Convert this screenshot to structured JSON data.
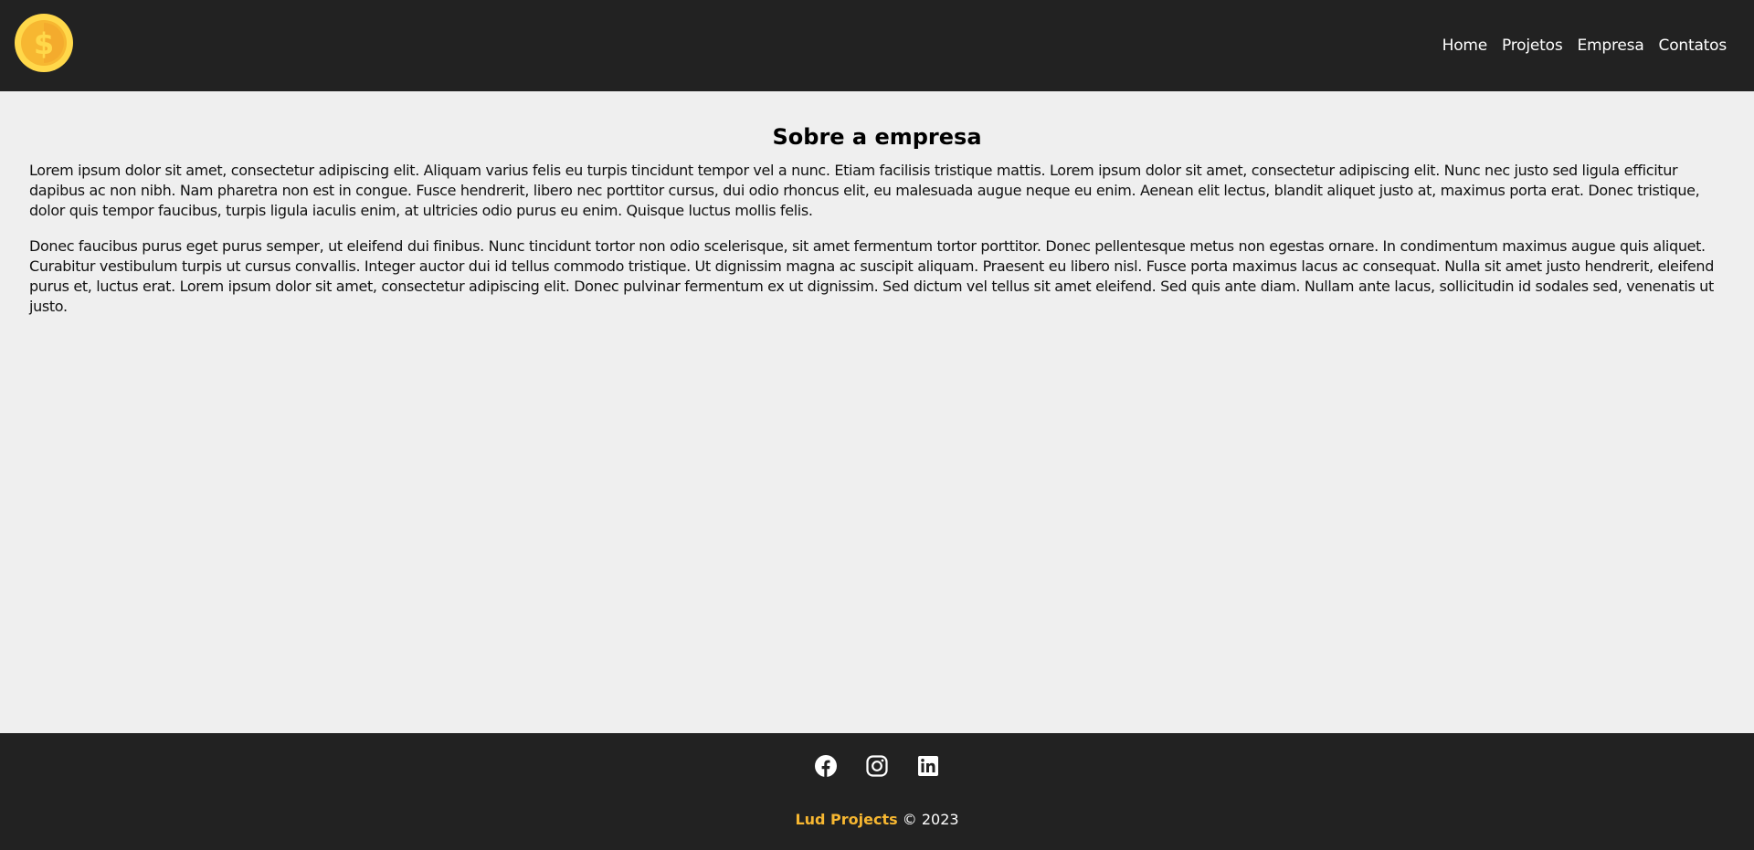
{
  "header": {
    "logo_icon": "dollar-coin-icon",
    "nav": [
      {
        "label": "Home"
      },
      {
        "label": "Projetos"
      },
      {
        "label": "Empresa"
      },
      {
        "label": "Contatos"
      }
    ]
  },
  "main": {
    "title": "Sobre a empresa",
    "paragraphs": [
      "Lorem ipsum dolor sit amet, consectetur adipiscing elit. Aliquam varius felis eu turpis tincidunt tempor vel a nunc. Etiam facilisis tristique mattis. Lorem ipsum dolor sit amet, consectetur adipiscing elit. Nunc nec justo sed ligula efficitur dapibus ac non nibh. Nam pharetra non est in congue. Fusce hendrerit, libero nec porttitor cursus, dui odio rhoncus elit, eu malesuada augue neque eu enim. Aenean elit lectus, blandit aliquet justo at, maximus porta erat. Donec tristique, dolor quis tempor faucibus, turpis ligula iaculis enim, at ultricies odio purus eu enim. Quisque luctus mollis felis.",
      "Donec faucibus purus eget purus semper, ut eleifend dui finibus. Nunc tincidunt tortor non odio scelerisque, sit amet fermentum tortor porttitor. Donec pellentesque metus non egestas ornare. In condimentum maximus augue quis aliquet. Curabitur vestibulum turpis ut cursus convallis. Integer auctor dui id tellus commodo tristique. Ut dignissim magna ac suscipit aliquam. Praesent eu libero nisl. Fusce porta maximus lacus ac consequat. Nulla sit amet justo hendrerit, eleifend purus et, luctus erat. Lorem ipsum dolor sit amet, consectetur adipiscing elit. Donec pulvinar fermentum ex ut dignissim. Sed dictum vel tellus sit amet eleifend. Sed quis ante diam. Nullam ante lacus, sollicitudin id sodales sed, venenatis ut justo."
    ]
  },
  "footer": {
    "social": [
      "facebook-icon",
      "instagram-icon",
      "linkedin-icon"
    ],
    "brand": "Lud Projects",
    "copyright": "© 2023"
  },
  "colors": {
    "header_bg": "#222222",
    "page_bg": "#efefef",
    "accent": "#f7b731"
  }
}
